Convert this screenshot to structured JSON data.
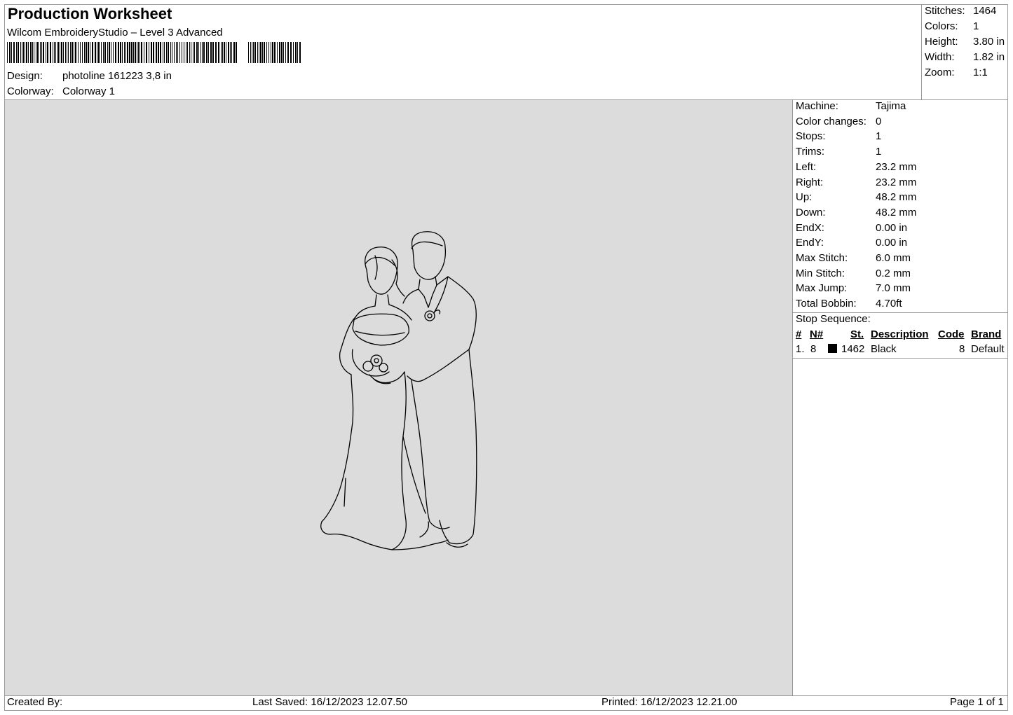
{
  "header": {
    "title": "Production Worksheet",
    "software": "Wilcom EmbroideryStudio – Level 3 Advanced",
    "barcode_icon": "barcode-icon",
    "design_label": "Design:",
    "design_value": "photoline 161223 3,8 in",
    "colorway_label": "Colorway:",
    "colorway_value": "Colorway 1"
  },
  "summary": [
    {
      "label": "Stitches:",
      "value": "1464"
    },
    {
      "label": "Colors:",
      "value": "1"
    },
    {
      "label": "Height:",
      "value": "3.80 in"
    },
    {
      "label": "Width:",
      "value": "1.82 in"
    },
    {
      "label": "Zoom:",
      "value": "1:1"
    }
  ],
  "machine_info": [
    {
      "label": "Machine:",
      "value": "Tajima"
    },
    {
      "label": "Color changes:",
      "value": "0"
    },
    {
      "label": "Stops:",
      "value": "1"
    },
    {
      "label": "Trims:",
      "value": "1"
    },
    {
      "label": "Left:",
      "value": "23.2 mm"
    },
    {
      "label": "Right:",
      "value": "23.2 mm"
    },
    {
      "label": "Up:",
      "value": "48.2 mm"
    },
    {
      "label": "Down:",
      "value": "48.2 mm"
    },
    {
      "label": "EndX:",
      "value": "0.00 in"
    },
    {
      "label": "EndY:",
      "value": "0.00 in"
    },
    {
      "label": "Max Stitch:",
      "value": "6.0 mm"
    },
    {
      "label": "Min Stitch:",
      "value": "0.2 mm"
    },
    {
      "label": "Max Jump:",
      "value": "7.0 mm"
    },
    {
      "label": "Total Bobbin:",
      "value": "4.70ft"
    }
  ],
  "stop_sequence": {
    "title": "Stop Sequence:",
    "headers": {
      "num": "#",
      "needle": "N#",
      "st": "St.",
      "description": "Description",
      "code": "Code",
      "brand": "Brand"
    },
    "rows": [
      {
        "num": "1.",
        "needle": "8",
        "swatch_color": "#000000",
        "st": "1462",
        "description": "Black",
        "code": "8",
        "brand": "Default"
      }
    ]
  },
  "preview": {
    "background": "#dcdcdc",
    "stitch_color": "#000000",
    "artwork_icon": "couple-line-art-icon"
  },
  "footer": {
    "created_by": "Created By:",
    "last_saved": "Last Saved: 16/12/2023 12.07.50",
    "printed": "Printed: 16/12/2023 12.21.00",
    "page": "Page 1 of 1"
  }
}
